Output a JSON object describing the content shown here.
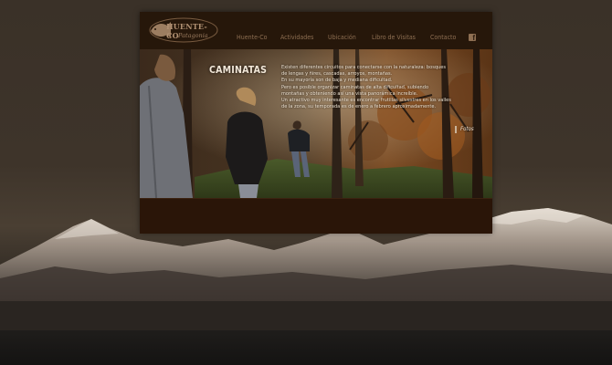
{
  "logo": {
    "name": "HUENTE-CO",
    "tagline": "Patagonia"
  },
  "nav": {
    "items": [
      {
        "label": "Huente-Co"
      },
      {
        "label": "Actividades"
      },
      {
        "label": "Ubicación"
      },
      {
        "label": "Libro de Visitas"
      },
      {
        "label": "Contacto"
      }
    ],
    "facebook_icon": "facebook-icon"
  },
  "hero": {
    "title": "CAMINATAS",
    "paragraph_lines": [
      "Existen diferentes circuitos para conectarse con la naturaleza: bosques",
      "de lengas y ñires, cascadas, arroyos, montañas.",
      "En su mayoría son de baja y mediana dificultad.",
      "Pero es posible organizar caminatas de alta dificultad, subiendo",
      "montañas y obteniendo así una vista panorámica increíble.",
      "Un atractivo muy interesante es encontrar frutillas silvestres en los valles",
      "de la zona, su temporada es de enero a febrero aproximadamente."
    ],
    "fotos_link": "Fotos"
  },
  "colors": {
    "panel": "#231509",
    "nav_text": "#8e6f52",
    "hero_text": "#efe3d2"
  }
}
